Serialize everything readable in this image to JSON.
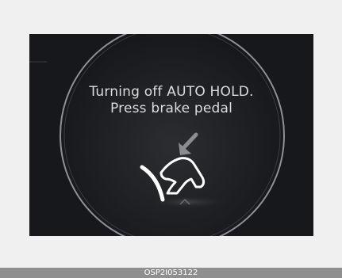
{
  "display": {
    "line1": "Turning off AUTO HOLD.",
    "line2": "Press brake pedal",
    "icon": "brake-pedal-press-icon"
  },
  "caption": {
    "code": "OSP2I053122"
  },
  "colors": {
    "screen_background": "#17181b",
    "text": "#dcdcdc",
    "caption_bar": "#8f8f8f",
    "page_background": "#f0f0f0"
  }
}
